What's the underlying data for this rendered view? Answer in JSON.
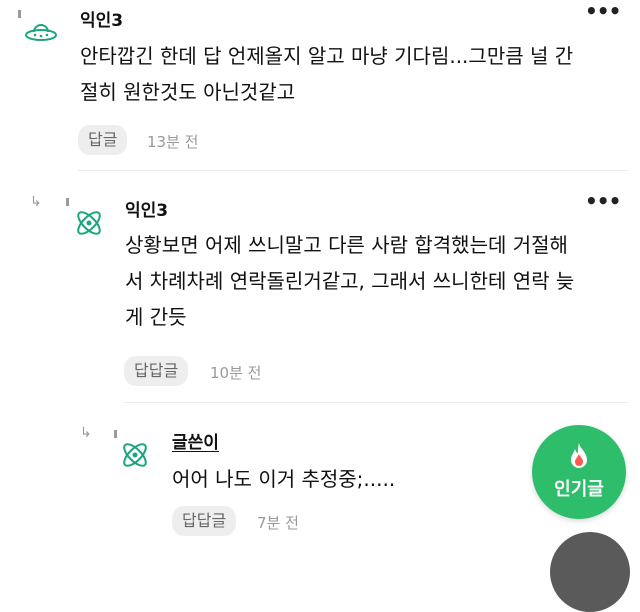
{
  "comments": [
    {
      "name": "익인3",
      "avatar_icon": "ufo-icon",
      "lines": [
        "안타깝긴 한데 답 언제올지 알고 마냥 기다림...그만큼 널 간",
        "절히 원한것도 아닌것같고"
      ],
      "reply_label": "답글",
      "time": "13분 전"
    },
    {
      "name": "익인3",
      "avatar_icon": "atom-icon",
      "lines": [
        "상황보면 어제 쓰니말고 다른 사람 합격했는데 거절해",
        "서 차례차례 연락돌린거같고, 그래서 쓰니한테 연락 늦",
        "게 간듯"
      ],
      "reply_label": "답답글",
      "time": "10분 전"
    },
    {
      "name": "글쓴이",
      "avatar_icon": "atom-icon",
      "lines": [
        "어어 나도 이거 추정중;....."
      ],
      "reply_label": "답답글",
      "time": "7분 전"
    }
  ],
  "more_label": "•••",
  "popular_button": {
    "label": "인기글",
    "icon": "fire-icon",
    "color": "#2ebd6b"
  },
  "colors": {
    "accent": "#2ebd6b",
    "icon_teal": "#1aa57e"
  }
}
